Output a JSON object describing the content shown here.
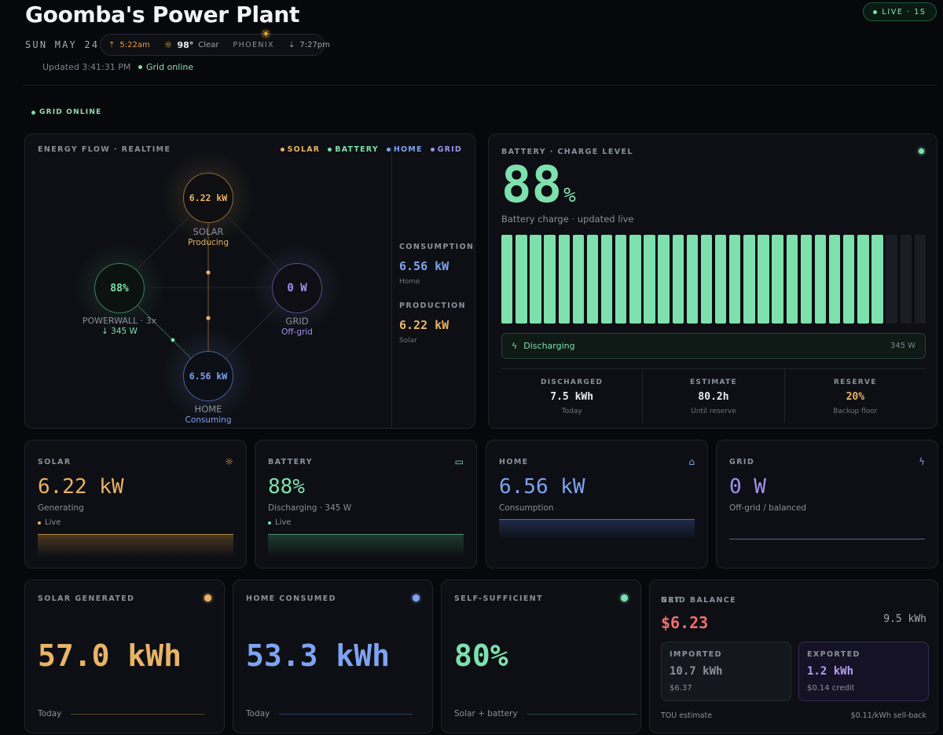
{
  "header": {
    "title": "Goomba's Power Plant",
    "date": "SUN MAY 24",
    "sunrise": "5:22am",
    "temperature": "98°",
    "condition": "Clear",
    "city": "PHOENIX",
    "sunset": "7:27pm",
    "updated": "Updated 3:41:31 PM",
    "grid_status": "Grid online",
    "live_label": "LIVE · 1S",
    "grid_tag": "GRID ONLINE"
  },
  "colors": {
    "solar": "#e9b366",
    "battery": "#7ee0ac",
    "home": "#7ea3f0",
    "grid": "#a690ec",
    "negative": "#ef7070"
  },
  "energy_flow": {
    "title": "ENERGY FLOW · REALTIME",
    "legend": [
      "SOLAR",
      "BATTERY",
      "HOME",
      "GRID"
    ],
    "solar": {
      "value": "6.22 kW",
      "label": "SOLAR",
      "status": "Producing"
    },
    "powerwall": {
      "value": "88%",
      "label": "POWERWALL · 3x",
      "status": "↓ 345 W"
    },
    "grid": {
      "value": "0 W",
      "label": "GRID",
      "status": "Off-grid"
    },
    "home": {
      "value": "6.56 kW",
      "label": "HOME",
      "status": "Consuming"
    },
    "consumption": {
      "label": "CONSUMPTION",
      "value": "6.56 kW",
      "sub": "Home"
    },
    "production": {
      "label": "PRODUCTION",
      "value": "6.22 kW",
      "sub": "Solar"
    }
  },
  "battery": {
    "title": "BATTERY · CHARGE LEVEL",
    "level": "88",
    "pct_sign": "%",
    "subtitle": "Battery charge · updated live",
    "bars_total": 30,
    "bars_filled": 27,
    "status": "Discharging",
    "status_power": "345 W",
    "stats": [
      {
        "label": "DISCHARGED",
        "value": "7.5 kWh",
        "sub": "Today"
      },
      {
        "label": "ESTIMATE",
        "value": "80.2h",
        "sub": "Until reserve"
      },
      {
        "label": "RESERVE",
        "value": "20%",
        "sub": "Backup floor"
      }
    ]
  },
  "metrics": [
    {
      "label": "SOLAR",
      "value": "6.22 kW",
      "sub": "Generating",
      "live": "Live",
      "icon": "sun-icon"
    },
    {
      "label": "BATTERY",
      "value": "88%",
      "sub": "Discharging · 345 W",
      "live": "Live",
      "icon": "battery-icon"
    },
    {
      "label": "HOME",
      "value": "6.56 kW",
      "sub": "Consumption",
      "icon": "house-icon"
    },
    {
      "label": "GRID",
      "value": "0 W",
      "sub": "Off-grid / balanced",
      "icon": "bolt-icon"
    }
  ],
  "totals": [
    {
      "label": "SOLAR GENERATED",
      "value": "57.0 kWh",
      "foot": "Today"
    },
    {
      "label": "HOME CONSUMED",
      "value": "53.3 kWh",
      "foot": "Today"
    },
    {
      "label": "SELF-SUFFICIENT",
      "value": "80%",
      "foot": "Solar + battery"
    }
  ],
  "grid_balance": {
    "label": "GRID BALANCE",
    "balance": "$6.23",
    "net_label": "NET",
    "net_value": "9.5 kWh",
    "imported": {
      "label": "IMPORTED",
      "value": "10.7 kWh",
      "cost": "$6.37"
    },
    "exported": {
      "label": "EXPORTED",
      "value": "1.2 kWh",
      "cost": "$0.14 credit"
    },
    "foot_left": "TOU estimate",
    "foot_right": "$0.11/kWh sell-back"
  }
}
